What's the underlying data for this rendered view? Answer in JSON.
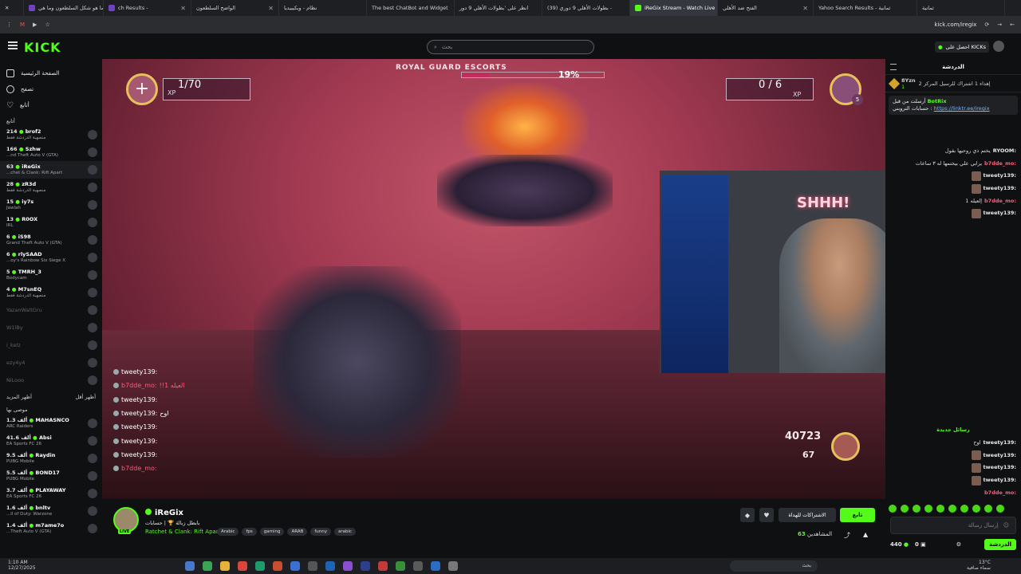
{
  "browser": {
    "tabs": [
      {
        "label": "ثمانية"
      },
      {
        "label": "Yahoo Search Results - ثمانية"
      },
      {
        "label": "الفتح ضد الأهلي"
      },
      {
        "label": "iReGix Stream - Watch Live"
      },
      {
        "label": "(39) بطولات الأهلي 9 دوري -"
      },
      {
        "label": "انظر على 'بطولات الأهلي 9 دور"
      },
      {
        "label": "The best ChatBot and Widget"
      },
      {
        "label": "نظام - ويكيبيديا"
      },
      {
        "label": "الواضح السلطعون"
      },
      {
        "label": "ch Results -"
      },
      {
        "label": "ما هو شكل السلطعون وما هي"
      }
    ],
    "url": "kick.com/iregix"
  },
  "header": {
    "logo": "KICK",
    "search_placeholder": "بحث",
    "get_kicks": "احصل على KICKs"
  },
  "sidebar": {
    "main": [
      {
        "label": "الصفحة الرئيسية",
        "icon": "home-icon"
      },
      {
        "label": "تصفح",
        "icon": "compass-icon"
      },
      {
        "label": "أتابع",
        "icon": "heart-icon"
      }
    ],
    "following_header": "أتابع",
    "following": [
      {
        "name": "brof2",
        "game": "منصهبة الدردشة فقط",
        "viewers": "214",
        "online": true
      },
      {
        "name": "Szhw",
        "game": "...nd Theft Auto V (GTA)",
        "viewers": "166",
        "online": true
      },
      {
        "name": "iReGix",
        "game": "...chet & Clank: Rift Apart",
        "viewers": "63",
        "online": true,
        "active": true
      },
      {
        "name": "zR3d",
        "game": "منصهبة الدردشة فقط",
        "viewers": "28",
        "online": true
      },
      {
        "name": "iy7s",
        "game": "Jawlah",
        "viewers": "15",
        "online": true
      },
      {
        "name": "R0OX",
        "game": "IRL",
        "viewers": "13",
        "online": true
      },
      {
        "name": "iS98",
        "game": "Grand Theft Auto V (GTA)",
        "viewers": "6",
        "online": true
      },
      {
        "name": "rlySAAD",
        "game": "...oy's Rainbow Six Siege X",
        "viewers": "6",
        "online": true
      },
      {
        "name": "TMRH_3",
        "game": "Bodycam",
        "viewers": "5",
        "online": true
      },
      {
        "name": "M7snEQ",
        "game": "منصهبة الدردشة فقط",
        "viewers": "4",
        "online": true
      },
      {
        "name": "YazanWaltGru",
        "game": "",
        "viewers": "",
        "online": false
      },
      {
        "name": "W1lBy",
        "game": "",
        "viewers": "",
        "online": false
      },
      {
        "name": "i_kelz",
        "game": "",
        "viewers": "",
        "online": false
      },
      {
        "name": "ezy4y4",
        "game": "",
        "viewers": "",
        "online": false
      },
      {
        "name": "NiLooo",
        "game": "",
        "viewers": "",
        "online": false
      }
    ],
    "show_more": "أظهر المزيد",
    "show_less": "أظهر أقل",
    "recommended_header": "موصى بها",
    "recommended": [
      {
        "name": "MAHASNCO",
        "game": "ARC Raiders",
        "viewers": "1.3 ألف"
      },
      {
        "name": "Absi",
        "game": "EA Sports FC 26",
        "viewers": "41.6 ألف"
      },
      {
        "name": "Raydin",
        "game": "PUBG Mobile",
        "viewers": "9.5 ألف"
      },
      {
        "name": "BOND17",
        "game": "PUBG Mobile",
        "viewers": "5.5 ألف"
      },
      {
        "name": "PLAYAWAY",
        "game": "EA Sports FC 26",
        "viewers": "3.7 ألف"
      },
      {
        "name": "bnltv",
        "game": "...ll of Duty: Warzone",
        "viewers": "1.6 ألف"
      },
      {
        "name": "m7ame7o",
        "game": "...Theft Auto V (GTA)",
        "viewers": "1.4 ألف"
      }
    ]
  },
  "video": {
    "mission": "ROYAL GUARD ESCORTS",
    "boss_percent": "19%",
    "boss_fraction": 0.19,
    "left_counter": "1/70",
    "left_xp": "XP",
    "right_counter": "0 / 6",
    "right_xp": "XP",
    "right_badge": "5",
    "bolts": "40723",
    "ammo": "67",
    "overlay_chat": [
      {
        "user": "tweety139:",
        "text": "",
        "red": false
      },
      {
        "user": "b7dde_mo:",
        "text": "!!العيله 1",
        "red": true
      },
      {
        "user": "tweety139:",
        "text": "",
        "red": false
      },
      {
        "user": "tweety139:",
        "text": "اوح",
        "red": false
      },
      {
        "user": "tweety139:",
        "text": "",
        "red": false
      },
      {
        "user": "tweety139:",
        "text": "",
        "red": false
      },
      {
        "user": "tweety139:",
        "text": "",
        "red": false
      },
      {
        "user": "b7dde_mo:",
        "text": "",
        "red": true
      }
    ],
    "webcam_sign": "SHHH!"
  },
  "chat": {
    "title": "الدردشة",
    "gift": "إهداء 1 اشتراك للرسيل المركز 2",
    "gift_user": "8Yzn",
    "gift_count": "1",
    "pinned_user": "BotRix",
    "pinned_from": "أرسلت من قبل",
    "pinned_text": "حسابات التروبني :",
    "pinned_link": "https://linktr.ee/iregix",
    "messages": [
      {
        "user": "RYOOM:",
        "text": "يختم ذي روحيها بقول",
        "red": false
      },
      {
        "user": "b7dde_mo:",
        "text": "يرابي علي بيختمها له ٣ ساعات",
        "red": true
      },
      {
        "user": "tweety139:",
        "text": "",
        "red": false
      },
      {
        "user": "tweety139:",
        "text": "",
        "red": false
      },
      {
        "user": "b7dde_mo:",
        "text": "إلعيله 1",
        "red": true
      },
      {
        "user": "tweety139:",
        "text": "",
        "red": false
      }
    ],
    "new_messages": "رسائل جديدة",
    "messages2": [
      {
        "user": "tweety139:",
        "text": "اوح",
        "red": false
      },
      {
        "user": "tweety139:",
        "text": "",
        "red": false
      },
      {
        "user": "tweety139:",
        "text": "",
        "red": false
      },
      {
        "user": "tweety139:",
        "text": "",
        "red": false
      },
      {
        "user": "b7dde_mo:",
        "text": "",
        "red": true
      }
    ],
    "input_placeholder": "إرسال رسالة",
    "points": "440",
    "zero": "0",
    "send_label": "الدردشة"
  },
  "stream": {
    "name": "iReGix",
    "title": "بابطل زبالة 🏆 | حسابات",
    "category": "Ratchet & Clank: Rift Apart",
    "tags": [
      "Arabic",
      "fps",
      "gaming",
      "ARAB",
      "funny",
      "arabic"
    ],
    "follow": "تابع",
    "subscribe": "الاشتراكات للهداة",
    "viewers_label": "المشاهدين",
    "viewers": "63"
  },
  "taskbar": {
    "time": "1:10 AM",
    "date": "12/27/2025",
    "search": "بحث",
    "temp": "13°C",
    "weather": "سماء صافية"
  },
  "colors": {
    "accent": "#53fc18",
    "background": "#0f1012",
    "red_user": "#ff5c7a"
  }
}
